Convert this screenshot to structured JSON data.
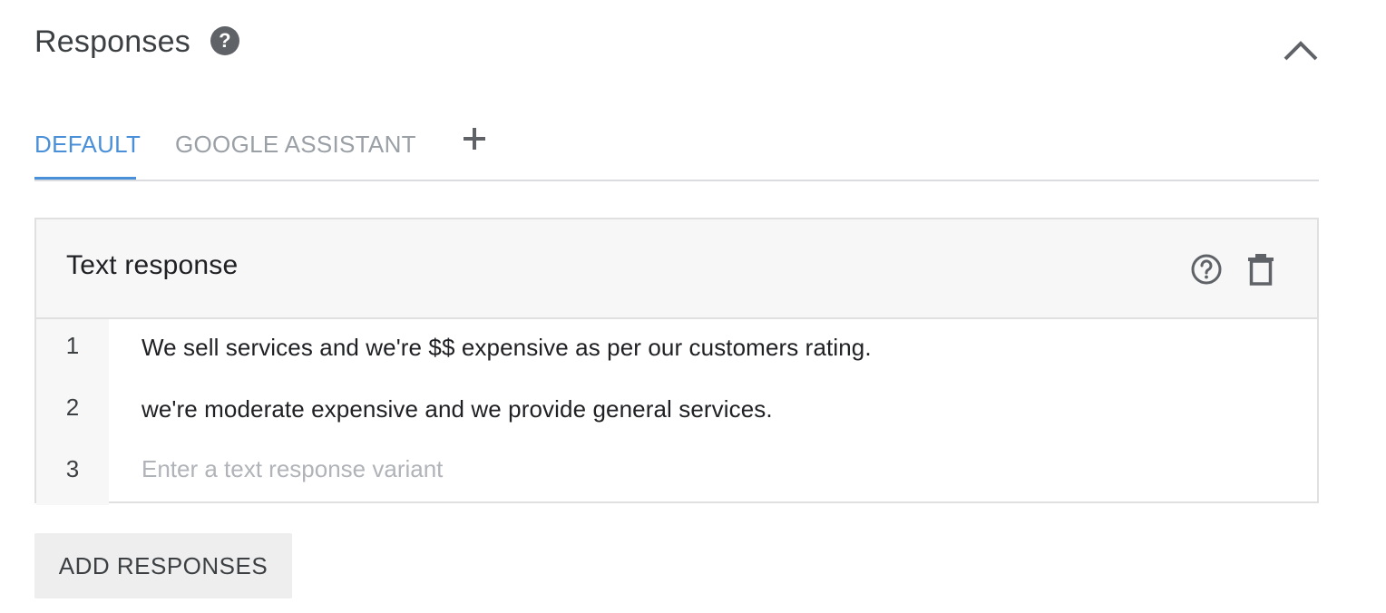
{
  "section": {
    "title": "Responses",
    "help_icon": "help-circle-icon",
    "collapse_icon": "chevron-up-icon"
  },
  "tabs": [
    {
      "label": "DEFAULT",
      "active": true
    },
    {
      "label": "GOOGLE ASSISTANT",
      "active": false
    }
  ],
  "add_tab_icon": "plus-icon",
  "card": {
    "title": "Text response",
    "help_icon": "help-outline-icon",
    "delete_icon": "trash-icon",
    "rows": [
      {
        "number": "1",
        "text": "We sell services and we're $$ expensive as per our customers rating."
      },
      {
        "number": "2",
        "text": "we're moderate expensive and we provide general services."
      },
      {
        "number": "3",
        "text": "",
        "placeholder": "Enter a text response variant"
      }
    ]
  },
  "add_responses_label": "ADD RESPONSES",
  "colors": {
    "accent": "#4a90d9",
    "inactive_tab": "#9aa0a6",
    "card_header_bg": "#f7f7f7",
    "button_bg": "#eeeeee"
  }
}
